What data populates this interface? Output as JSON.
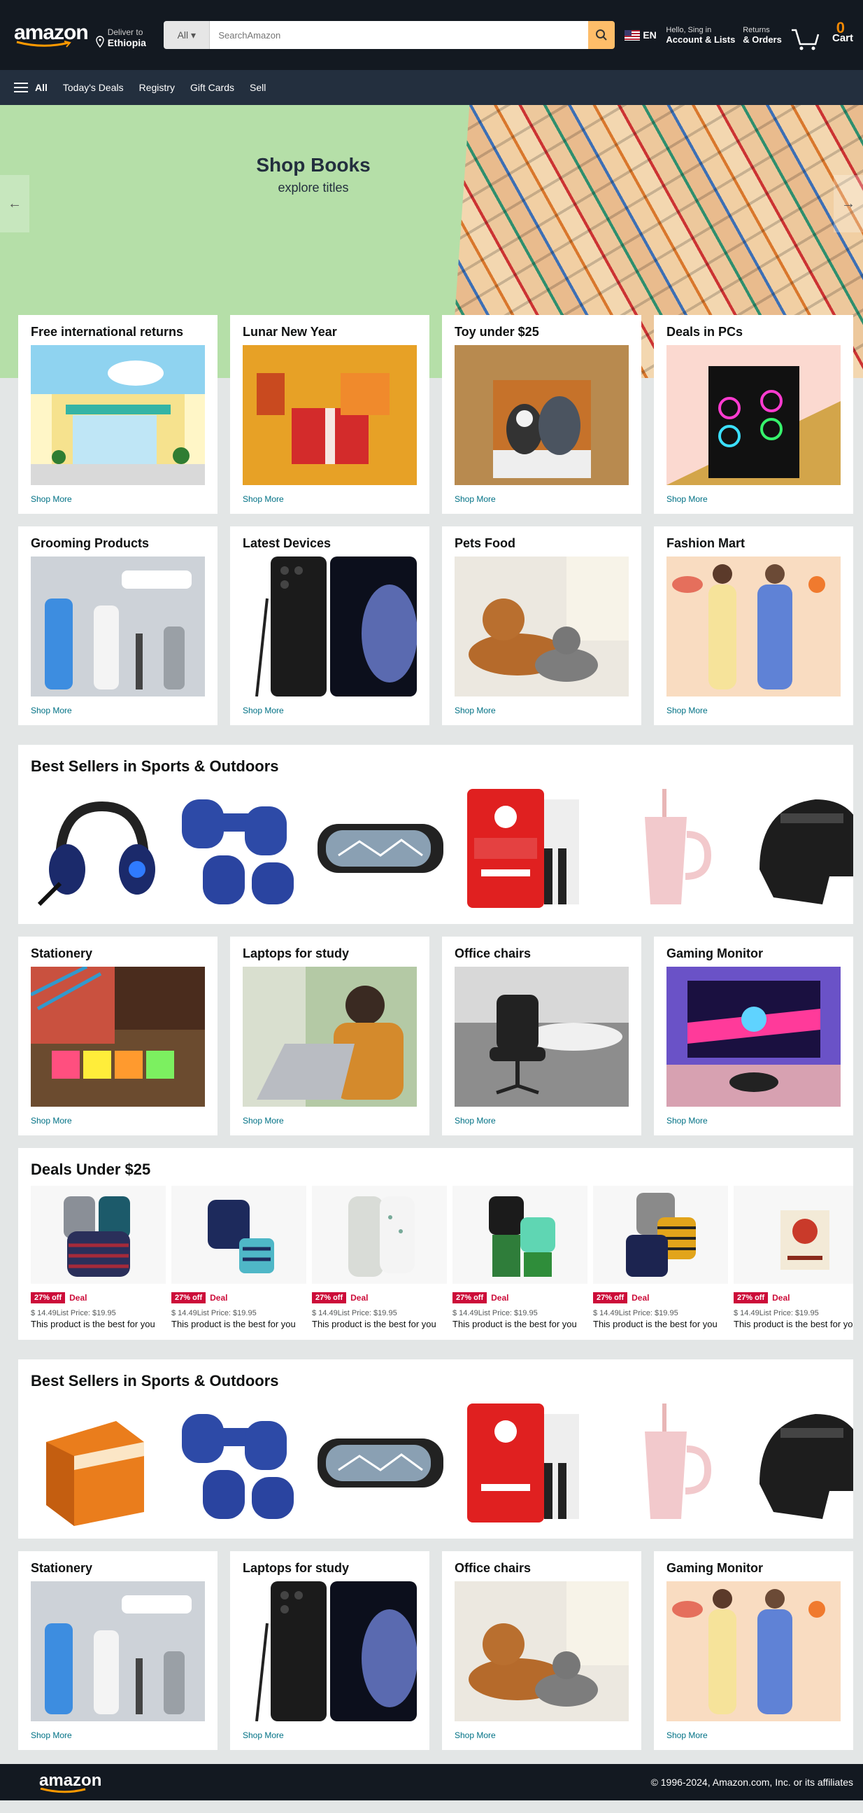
{
  "header": {
    "logo": "amazon",
    "deliver_to": "Deliver to",
    "location": "Ethiopia",
    "search_category": "All",
    "search_placeholder": "SearchAmazon",
    "language": "EN",
    "greeting": "Hello, Sing in",
    "account": "Account & Lists",
    "returns": "Returns",
    "orders": "& Orders",
    "cart_count": "0",
    "cart": "Cart"
  },
  "nav": {
    "all": "All",
    "items": [
      "Today's Deals",
      "Registry",
      "Gift Cards",
      "Sell"
    ]
  },
  "hero": {
    "title": "Shop Books",
    "subtitle": "explore titles"
  },
  "row1": [
    {
      "title": "Free international returns",
      "more": "Shop More"
    },
    {
      "title": "Lunar New Year",
      "more": "Shop More"
    },
    {
      "title": "Toy under $25",
      "more": "Shop More"
    },
    {
      "title": "Deals in PCs",
      "more": "Shop More"
    }
  ],
  "row2": [
    {
      "title": "Grooming Products",
      "more": "Shop More"
    },
    {
      "title": "Latest Devices",
      "more": "Shop More"
    },
    {
      "title": "Pets Food",
      "more": "Shop More"
    },
    {
      "title": "Fashion Mart",
      "more": "Shop More"
    }
  ],
  "band1": {
    "title": "Best Sellers in Sports & Outdoors"
  },
  "row3": [
    {
      "title": "Stationery",
      "more": "Shop More"
    },
    {
      "title": "Laptops for study",
      "more": "Shop More"
    },
    {
      "title": "Office chairs",
      "more": "Shop More"
    },
    {
      "title": "Gaming Monitor",
      "more": "Shop More"
    }
  ],
  "deals": {
    "title": "Deals Under $25",
    "off": "27% off",
    "deal": "Deal",
    "price": "$ 14.49List Price: $19.95",
    "desc": "This product is the best for you"
  },
  "band2": {
    "title": "Best Sellers in Sports & Outdoors"
  },
  "row4": [
    {
      "title": "Stationery",
      "more": "Shop More"
    },
    {
      "title": "Laptops for study",
      "more": "Shop More"
    },
    {
      "title": "Office chairs",
      "more": "Shop More"
    },
    {
      "title": "Gaming Monitor",
      "more": "Shop More"
    }
  ],
  "footer": {
    "logo": "amazon",
    "copyright": "© 1996-2024, Amazon.com, Inc. or its affiliates"
  },
  "colors": {
    "header": "#131921",
    "nav": "#232f3e",
    "accent": "#febd69",
    "link": "#007185",
    "deal": "#cc0c39"
  }
}
